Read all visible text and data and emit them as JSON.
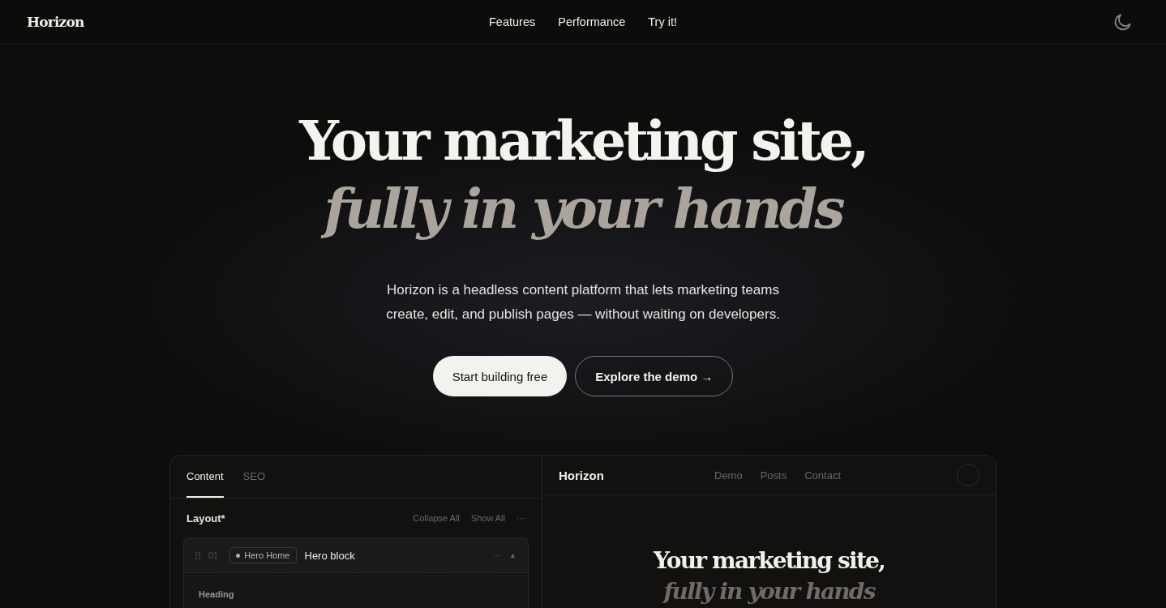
{
  "nav": {
    "brand": "Horizon",
    "links": [
      {
        "label": "Features"
      },
      {
        "label": "Performance"
      },
      {
        "label": "Try it!"
      }
    ]
  },
  "hero": {
    "title": "Your marketing site,",
    "title_italic": "fully in your hands",
    "description": "Horizon is a headless content platform that lets marketing teams create, edit, and publish pages — without waiting on developers.",
    "primary_button": "Start building free",
    "secondary_button": "Explore the demo →"
  },
  "editor": {
    "tabs": [
      {
        "label": "Content",
        "selected": true
      },
      {
        "label": "SEO",
        "selected": false
      }
    ],
    "section_title": "Layout*",
    "actions": [
      "Collapse All",
      "Show All",
      "···"
    ],
    "block": {
      "number": "01",
      "tag": "Hero Home",
      "title": "Hero block",
      "menu": "···",
      "toggle": "▲",
      "field_label": "Heading"
    }
  },
  "preview": {
    "brand": "Horizon",
    "links": [
      {
        "label": "Demo"
      },
      {
        "label": "Posts"
      },
      {
        "label": "Contact"
      }
    ],
    "title": "Your marketing site,",
    "title_italic": "fully in your hands"
  }
}
